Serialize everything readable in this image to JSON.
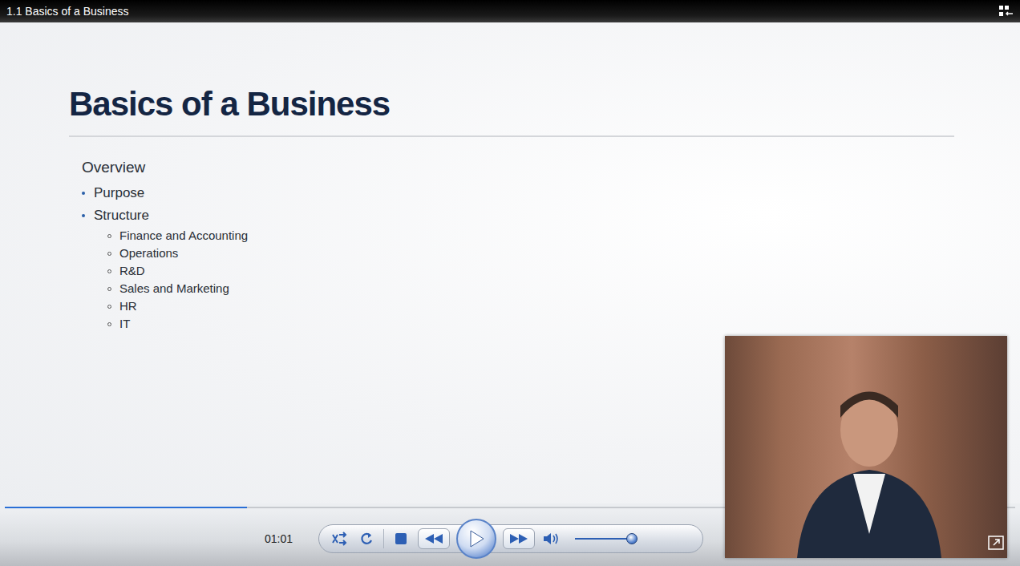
{
  "window": {
    "title": "1.1 Basics of a Business"
  },
  "slide": {
    "title": "Basics of a Business",
    "heading": "Overview",
    "items": [
      {
        "text": "Purpose",
        "kind": "bullet"
      },
      {
        "text": "Structure",
        "kind": "bullet"
      },
      {
        "text": "Finance and Accounting",
        "kind": "sub"
      },
      {
        "text": "Operations",
        "kind": "sub"
      },
      {
        "text": "R&D",
        "kind": "sub"
      },
      {
        "text": "Sales and Marketing",
        "kind": "sub"
      },
      {
        "text": "HR",
        "kind": "sub"
      },
      {
        "text": "IT",
        "kind": "sub"
      }
    ]
  },
  "player": {
    "playing": false,
    "progress": {
      "level": 0.24
    },
    "time": "01:01",
    "volume": {
      "level": 0.93
    }
  }
}
